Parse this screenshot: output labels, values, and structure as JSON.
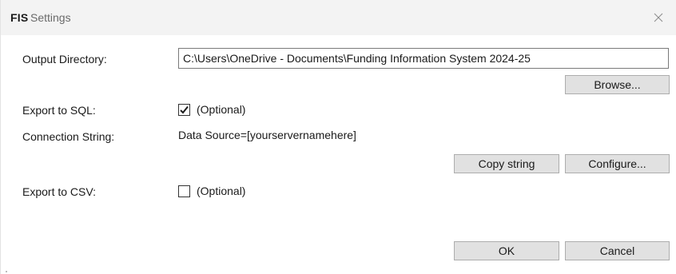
{
  "titlebar": {
    "logo": "FIS",
    "title": "Settings",
    "close_icon": "close-icon"
  },
  "output_directory": {
    "label": "Output Directory:",
    "value": "C:\\Users\\OneDrive - Documents\\Funding Information System 2024-25",
    "browse_label": "Browse..."
  },
  "export_sql": {
    "label": "Export to SQL:",
    "checked": true,
    "option_label": "(Optional)"
  },
  "connection_string": {
    "label": "Connection String:",
    "value": "Data Source=[yourservernamehere]",
    "copy_label": "Copy string",
    "configure_label": "Configure..."
  },
  "export_csv": {
    "label": "Export to CSV:",
    "checked": false,
    "option_label": "(Optional)"
  },
  "footer": {
    "ok_label": "OK",
    "cancel_label": "Cancel"
  },
  "colors": {
    "titlebar_bg": "#f3f3f3",
    "button_bg": "#e1e1e1",
    "button_border": "#adadad"
  }
}
